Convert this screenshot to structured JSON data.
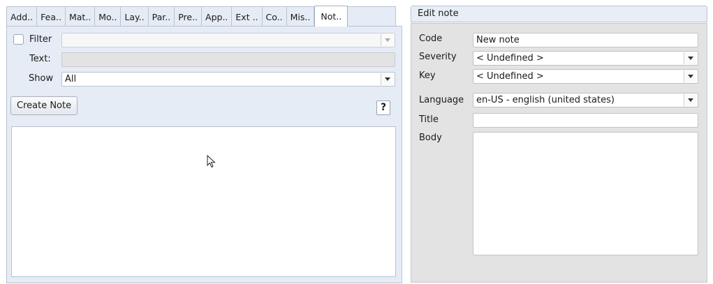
{
  "tabs": [
    {
      "label": "Add.."
    },
    {
      "label": "Fea.."
    },
    {
      "label": "Mat.."
    },
    {
      "label": "Mo.."
    },
    {
      "label": "Lay.."
    },
    {
      "label": "Par.."
    },
    {
      "label": "Pre.."
    },
    {
      "label": "App.."
    },
    {
      "label": "Ext .."
    },
    {
      "label": "Co.."
    },
    {
      "label": "Mis.."
    },
    {
      "label": "Not.."
    }
  ],
  "notes_panel": {
    "filter_label": "Filter",
    "filter_checked": false,
    "filter_value": "",
    "text_label": "Text:",
    "text_value": "",
    "show_label": "Show",
    "show_value": "All",
    "create_button": "Create Note",
    "help_button": "?"
  },
  "edit_note": {
    "header": "Edit note",
    "code_label": "Code",
    "code_value": "New note",
    "severity_label": "Severity",
    "severity_value": "< Undefined >",
    "key_label": "Key",
    "key_value": "< Undefined >",
    "language_label": "Language",
    "language_value": "en-US - english (united states)",
    "title_label": "Title",
    "title_value": "",
    "body_label": "Body",
    "body_value": ""
  }
}
